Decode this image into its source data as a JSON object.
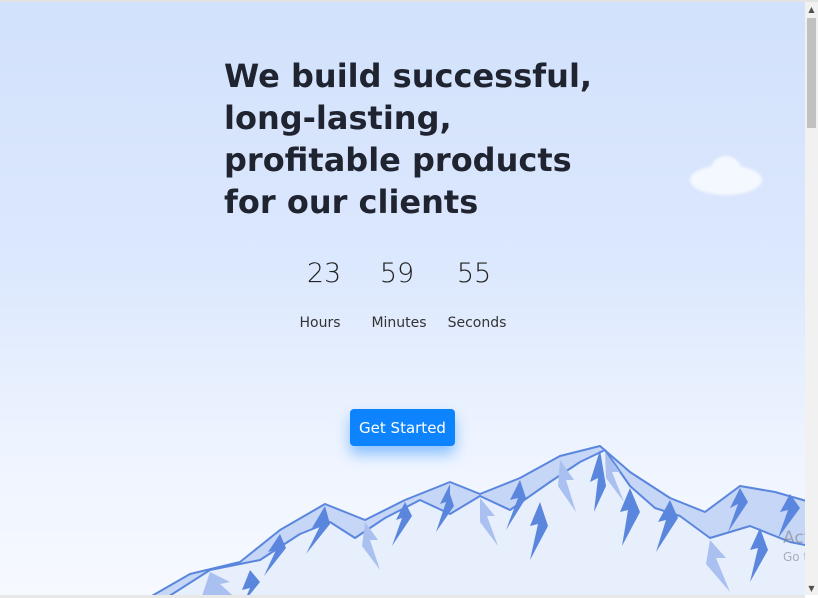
{
  "hero": {
    "headline_lines": [
      "We build successful,",
      "long-lasting,",
      "profitable products",
      "for our clients"
    ]
  },
  "countdown": {
    "hours": {
      "value": "23",
      "label": "Hours"
    },
    "minutes": {
      "value": "59",
      "label": "Minutes"
    },
    "seconds": {
      "value": "55",
      "label": "Seconds"
    }
  },
  "cta": {
    "label": "Get Started"
  },
  "watermark": {
    "line1": "Activate Windows",
    "line2": "Go to Settings to activate Windows."
  },
  "colors": {
    "accent": "#0d83fd",
    "mountain_dark": "#5a86de",
    "mountain_light": "#a9c0f1",
    "background": "#d2e1fc"
  }
}
